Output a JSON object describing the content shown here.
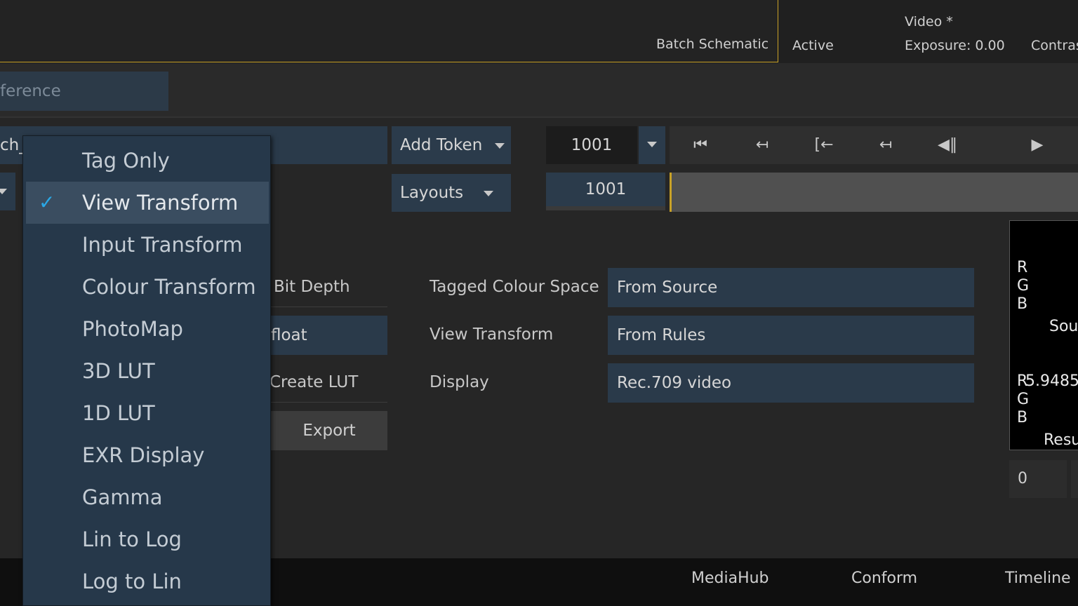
{
  "topbar": {
    "batch_schematic": "Batch Schematic",
    "active": "Active",
    "video": "Video *",
    "exposure": "Exposure: 0.00",
    "contrast": "Contras"
  },
  "reference_field": "ference",
  "name_field": "ch_",
  "add_token": "Add Token",
  "layouts": "Layouts",
  "frame": "1001",
  "frame2": "1001",
  "transport": [
    "⏮",
    "↤",
    "[←",
    "↤",
    "◀‖",
    "▶"
  ],
  "settings": {
    "bit_depth_label": "Bit Depth",
    "bit_depth_value": "float",
    "create_lut_label": "Create LUT",
    "export": "Export",
    "tagged_colour_space_label": "Tagged Colour Space",
    "tagged_colour_space_value": "From Source",
    "view_transform_label": "View Transform",
    "view_transform_value": "From Rules",
    "display_label": "Display",
    "display_value": "Rec.709 video"
  },
  "right_panel": {
    "r1": "R",
    "g1": "G",
    "b1": "B",
    "source": "Sour",
    "r2": "R",
    "value": "5.9485",
    "g2": "G",
    "b2": "B",
    "result": "Resu",
    "small_value": "0"
  },
  "bottom_tabs": {
    "mediahub": "MediaHub",
    "conform": "Conform",
    "timeline": "Timeline"
  },
  "menu": {
    "items": [
      "Tag Only",
      "View Transform",
      "Input Transform",
      "Colour Transform",
      "PhotoMap",
      "3D LUT",
      "1D LUT",
      "EXR Display",
      "Gamma",
      "Lin to Log",
      "Log to Lin"
    ],
    "selected": "View Transform",
    "check_icon": "✓"
  }
}
